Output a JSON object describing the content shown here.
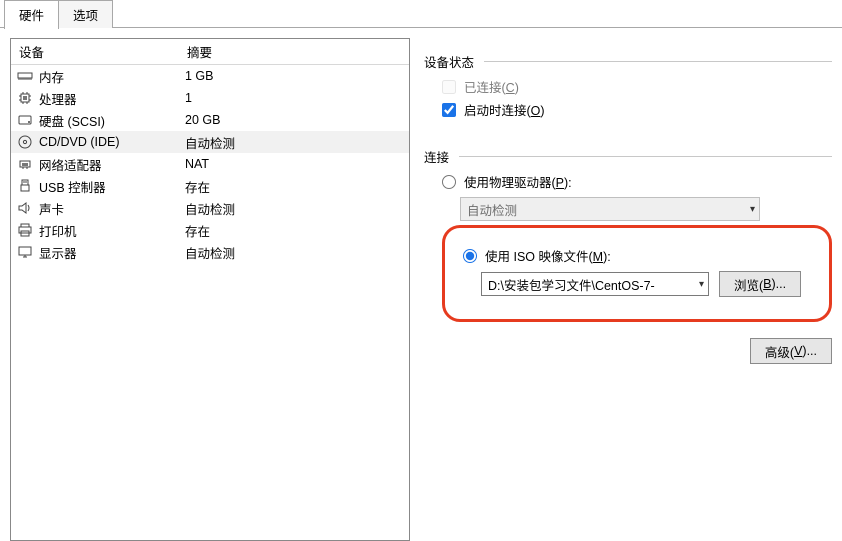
{
  "tabs": {
    "hardware": "硬件",
    "options": "选项"
  },
  "list": {
    "header_device": "设备",
    "header_summary": "摘要",
    "rows": [
      {
        "name": "内存",
        "summary": "1 GB",
        "icon": "memory-icon",
        "selected": false
      },
      {
        "name": "处理器",
        "summary": "1",
        "icon": "cpu-icon",
        "selected": false
      },
      {
        "name": "硬盘 (SCSI)",
        "summary": "20 GB",
        "icon": "disk-icon",
        "selected": false
      },
      {
        "name": "CD/DVD (IDE)",
        "summary": "自动检测",
        "icon": "cd-icon",
        "selected": true
      },
      {
        "name": "网络适配器",
        "summary": "NAT",
        "icon": "network-icon",
        "selected": false
      },
      {
        "name": "USB 控制器",
        "summary": "存在",
        "icon": "usb-icon",
        "selected": false
      },
      {
        "name": "声卡",
        "summary": "自动检测",
        "icon": "sound-icon",
        "selected": false
      },
      {
        "name": "打印机",
        "summary": "存在",
        "icon": "printer-icon",
        "selected": false
      },
      {
        "name": "显示器",
        "summary": "自动检测",
        "icon": "display-icon",
        "selected": false
      }
    ]
  },
  "status": {
    "group_title": "设备状态",
    "connected_label_pre": "已连接(",
    "connected_label_key": "C",
    "connected_label_post": ")",
    "connect_at_poweron_pre": "启动时连接(",
    "connect_at_poweron_key": "O",
    "connect_at_poweron_post": ")"
  },
  "connection": {
    "group_title": "连接",
    "physical_pre": "使用物理驱动器(",
    "physical_key": "P",
    "physical_post": "):",
    "physical_combo": "自动检测",
    "iso_pre": "使用 ISO 映像文件(",
    "iso_key": "M",
    "iso_post": "):",
    "iso_path": "D:\\安装包学习文件\\CentOS-7-",
    "browse_pre": "浏览(",
    "browse_key": "B",
    "browse_post": ")..."
  },
  "advanced": {
    "pre": "高级(",
    "key": "V",
    "post": ")..."
  }
}
